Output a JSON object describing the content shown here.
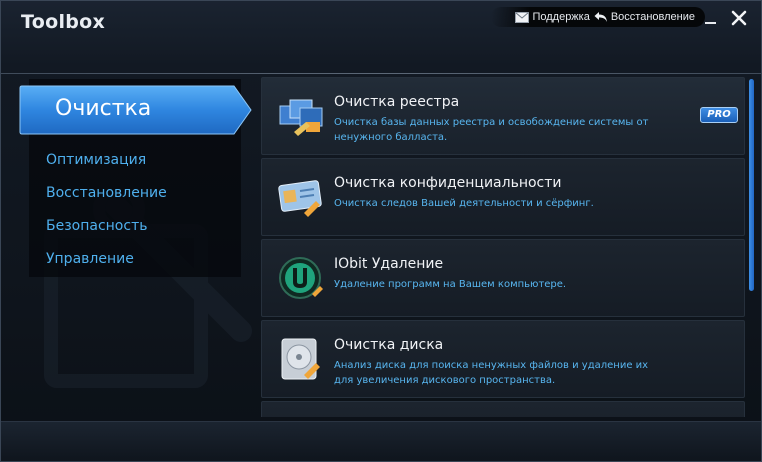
{
  "app": {
    "title": "Toolbox"
  },
  "header": {
    "support_label": "Поддержка",
    "support_icon": "mail-icon",
    "restore_label": "Восстановление",
    "restore_icon": "undo-arrow-icon"
  },
  "sidebar": {
    "active_label": "Очистка",
    "items": [
      {
        "label": "Оптимизация"
      },
      {
        "label": "Восстановление"
      },
      {
        "label": "Безопасность"
      },
      {
        "label": "Управление"
      }
    ]
  },
  "tools": [
    {
      "title": "Очистка реестра",
      "desc": "Очистка базы данных реестра и освобождение системы от ненужного балласта.",
      "badge": "PRO",
      "icon": "registry-cleaner-icon"
    },
    {
      "title": "Очистка конфиденциальности",
      "desc": "Очистка следов Вашей деятельности и сёрфинг.",
      "icon": "privacy-cleaner-icon"
    },
    {
      "title": "IObit Удаление",
      "desc": "Удаление программ на Вашем компьютере.",
      "icon": "iobit-uninstaller-icon"
    },
    {
      "title": "Очистка диска",
      "desc": "Анализ диска для поиска ненужных файлов и удаление их для увеличения дискового пространства.",
      "icon": "disk-cleaner-icon"
    }
  ],
  "colors": {
    "accent": "#2f86e0",
    "link": "#4fb0ee",
    "background": "#0f151d"
  }
}
